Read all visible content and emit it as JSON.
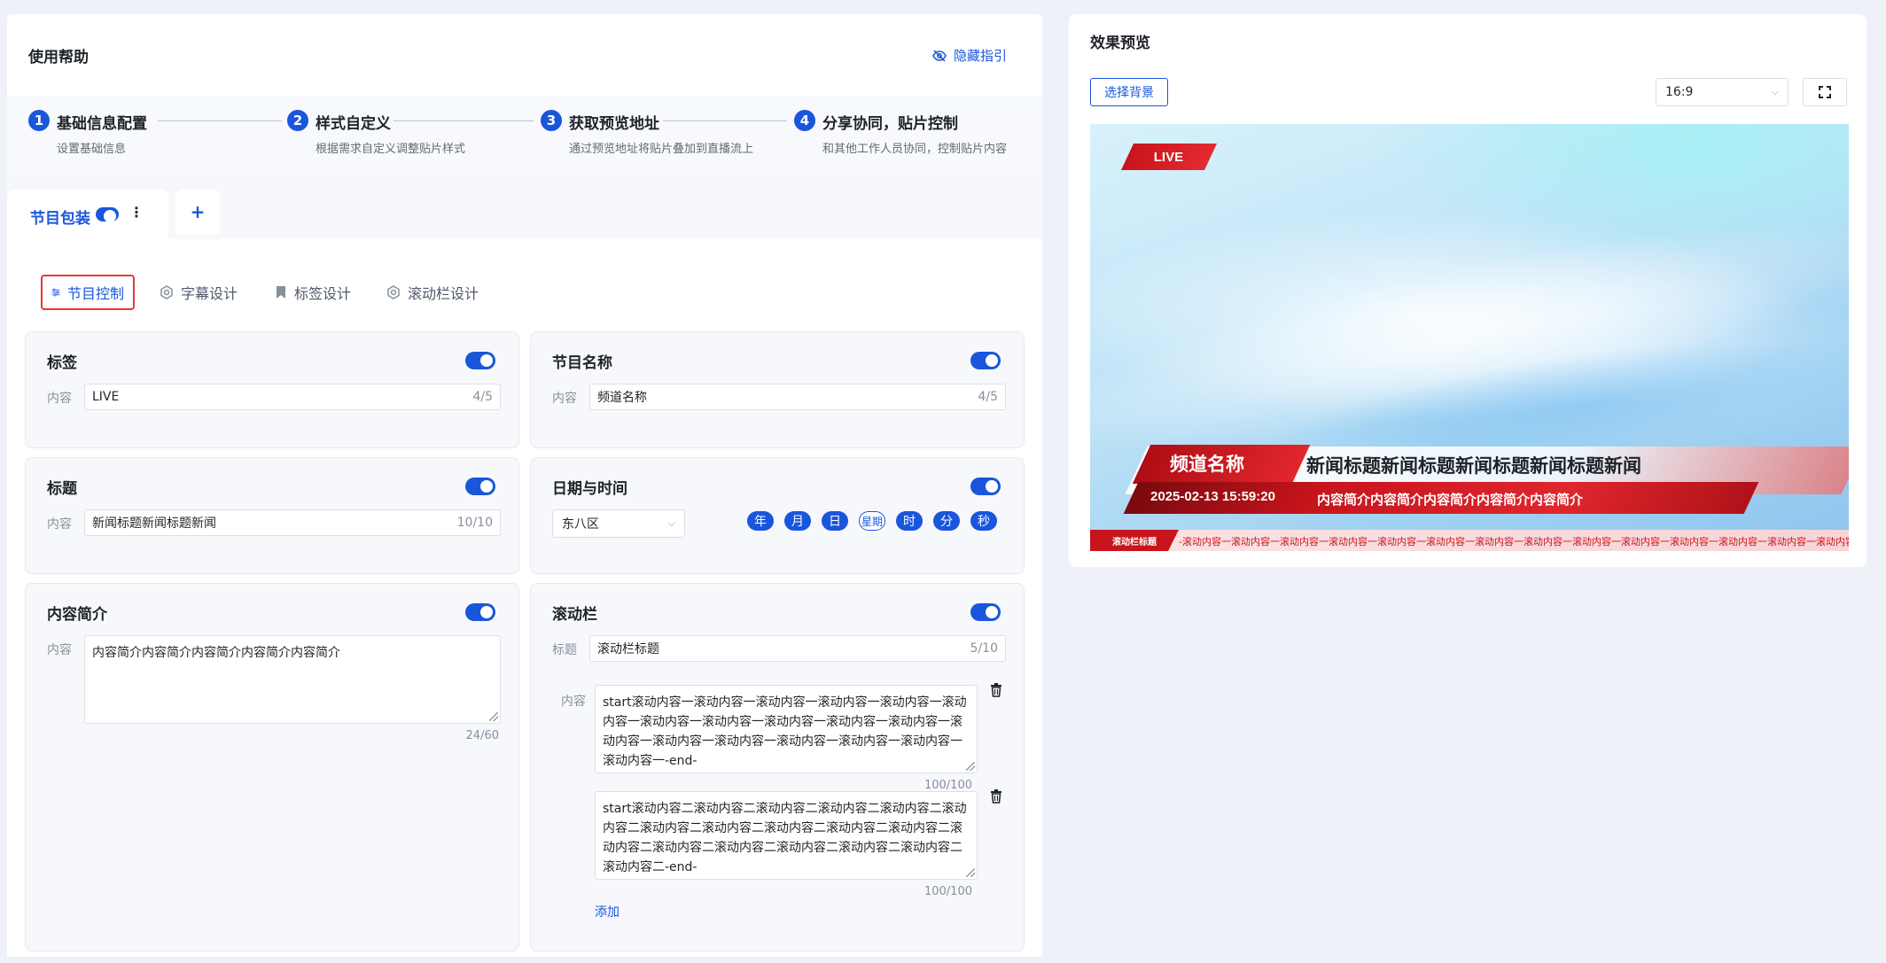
{
  "help": {
    "title": "使用帮助",
    "hide_guide": "隐藏指引",
    "steps": [
      {
        "num": "1",
        "title": "基础信息配置",
        "desc": "设置基础信息"
      },
      {
        "num": "2",
        "title": "样式自定义",
        "desc": "根据需求自定义调整贴片样式"
      },
      {
        "num": "3",
        "title": "获取预览地址",
        "desc": "通过预览地址将贴片叠加到直播流上"
      },
      {
        "num": "4",
        "title": "分享协同，贴片控制",
        "desc": "和其他工作人员协同，控制贴片内容"
      }
    ]
  },
  "tabs": {
    "main_label": "节目包装",
    "add_label": "+"
  },
  "subtabs": [
    {
      "label": "节目控制",
      "icon": "sliders-icon"
    },
    {
      "label": "字幕设计",
      "icon": "gear-icon"
    },
    {
      "label": "标签设计",
      "icon": "bookmark-icon"
    },
    {
      "label": "滚动栏设计",
      "icon": "gear-icon"
    }
  ],
  "panels": {
    "tag": {
      "title": "标签",
      "field_label": "内容",
      "value": "LIVE",
      "count": "4/5"
    },
    "program_name": {
      "title": "节目名称",
      "field_label": "内容",
      "value": "频道名称",
      "count": "4/5"
    },
    "headline": {
      "title": "标题",
      "field_label": "内容",
      "value": "新闻标题新闻标题新闻",
      "count": "10/10"
    },
    "datetime": {
      "title": "日期与时间",
      "timezone": "东八区",
      "units": [
        "年",
        "月",
        "日",
        "星期",
        "时",
        "分",
        "秒"
      ]
    },
    "intro": {
      "title": "内容简介",
      "field_label": "内容",
      "value": "内容简介内容简介内容简介内容简介内容简介",
      "count": "24/60"
    },
    "ticker": {
      "title": "滚动栏",
      "title_label": "标题",
      "title_value": "滚动栏标题",
      "title_count": "5/10",
      "content_label": "内容",
      "items": [
        {
          "text": "start滚动内容一滚动内容一滚动内容一滚动内容一滚动内容一滚动内容一滚动内容一滚动内容一滚动内容一滚动内容一滚动内容一滚动内容一滚动内容一滚动内容一滚动内容一滚动内容一滚动内容一滚动内容一-end-",
          "count": "100/100"
        },
        {
          "text": "start滚动内容二滚动内容二滚动内容二滚动内容二滚动内容二滚动内容二滚动内容二滚动内容二滚动内容二滚动内容二滚动内容二滚动内容二滚动内容二滚动内容二滚动内容二滚动内容二滚动内容二滚动内容二-end-",
          "count": "100/100"
        }
      ],
      "add_label": "添加"
    }
  },
  "preview": {
    "title": "效果预览",
    "choose_bg": "选择背景",
    "ratio": "16:9",
    "live": "LIVE",
    "channel": "频道名称",
    "headline": "新闻标题新闻标题新闻标题新闻标题新闻",
    "datetime": "2025-02-13 15:59:20",
    "desc": "内容简介内容简介内容简介内容简介内容简介",
    "ticker_title": "滚动栏标题",
    "ticker_text": "-滚动内容一滚动内容一滚动内容一滚动内容一滚动内容一滚动内容一滚动内容一滚动内容一滚动内容一滚动内容一滚动内容一滚动内容一滚动内容一滚动内容一滚动内容一-end-        start"
  },
  "colors": {
    "accent": "#1a56db",
    "live_red": "#c8141c",
    "highlight_border": "#e53935"
  }
}
